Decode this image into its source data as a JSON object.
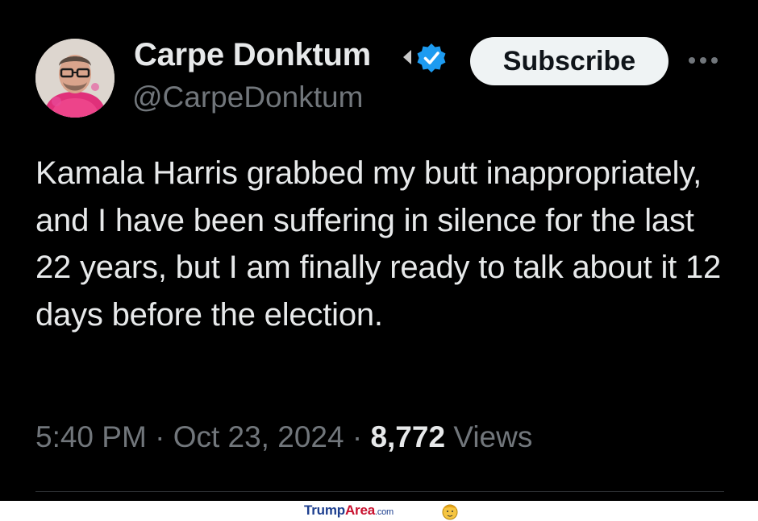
{
  "tweet": {
    "display_name": "Carpe Donktum",
    "handle": "@CarpeDonktum",
    "subscribe_label": "Subscribe",
    "text": "Kamala Harris grabbed my butt inappropriately, and I have been suffering in silence for the last 22 years, but I am finally ready to talk about it 12 days before the election.",
    "time": "5:40 PM",
    "date": "Oct 23, 2024",
    "separator": "·",
    "views_count": "8,772",
    "views_label": "Views",
    "icons": {
      "avatar": "avatar-photo",
      "affiliation": "affiliate-badge-icon",
      "verified": "verified-badge-icon",
      "more": "more-dots-icon"
    }
  },
  "footer": {
    "brand_part1": "Trump",
    "brand_part2": "Area",
    "brand_part3": ".com",
    "icon": "trump-face-icon"
  },
  "colors": {
    "background": "#000000",
    "text_primary": "#e7e9ea",
    "text_secondary": "#71767b",
    "verified_blue": "#1d9bf0",
    "button_bg": "#eff3f4",
    "divider": "#2f3336",
    "brand_blue": "#1d3f8f",
    "brand_red": "#c8102e"
  }
}
